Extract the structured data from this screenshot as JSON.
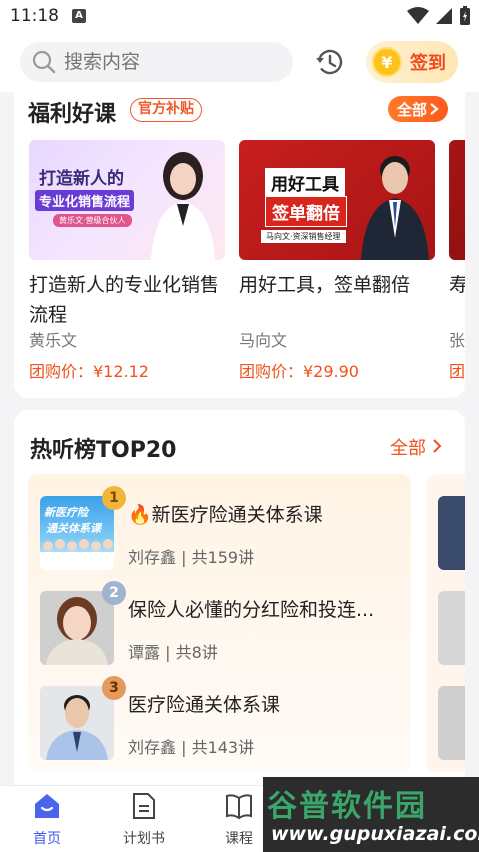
{
  "status_bar": {
    "time": "11:18",
    "notif_icon": "A"
  },
  "header": {
    "search_placeholder": "搜索内容",
    "signin_label": "签到",
    "coin_symbol": "¥"
  },
  "welfare": {
    "title": "福利好课",
    "tag": "官方补贴",
    "all_label": "全部",
    "courses": [
      {
        "title": "打造新人的专业化销售流程",
        "author": "黄乐文",
        "price": "团购价：¥12.12",
        "poster_line1": "打造新人的",
        "poster_line2": "专业化销售流程",
        "poster_sub": "黄乐文·营级合伙人"
      },
      {
        "title": "用好工具，签单翻倍",
        "author": "马向文",
        "price": "团购价：¥29.90",
        "poster_line1": "用好工具",
        "poster_line2": "签单翻倍",
        "poster_sub": "马向文·资深销售经理"
      },
      {
        "title": "寿...坛",
        "author": "张",
        "price": "团"
      }
    ]
  },
  "ranking": {
    "title": "热听榜TOP20",
    "all_label": "全部",
    "items": [
      {
        "rank": "1",
        "title": "新医疗险通关体系课",
        "meta": "刘存鑫 | 共159讲",
        "hot": "🔥",
        "poster_text1": "新医疗险",
        "poster_text2": "通关体系课"
      },
      {
        "rank": "2",
        "title": "保险人必懂的分红险和投连...",
        "meta": "谭露 | 共8讲"
      },
      {
        "rank": "3",
        "title": "医疗险通关体系课",
        "meta": "刘存鑫 | 共143讲"
      }
    ]
  },
  "tabbar": {
    "tabs": [
      {
        "label": "首页",
        "active": true
      },
      {
        "label": "计划书",
        "active": false
      },
      {
        "label": "课程",
        "active": false
      }
    ]
  },
  "watermark": {
    "line1": "谷普软件园",
    "line2": "www.gupuxiazai.com"
  },
  "colors": {
    "accent": "#f0521e",
    "tab_active": "#3d5be8",
    "medal_gold": "#f2b53a",
    "medal_silver": "#9fb4cf",
    "medal_bronze": "#e39a5c"
  }
}
